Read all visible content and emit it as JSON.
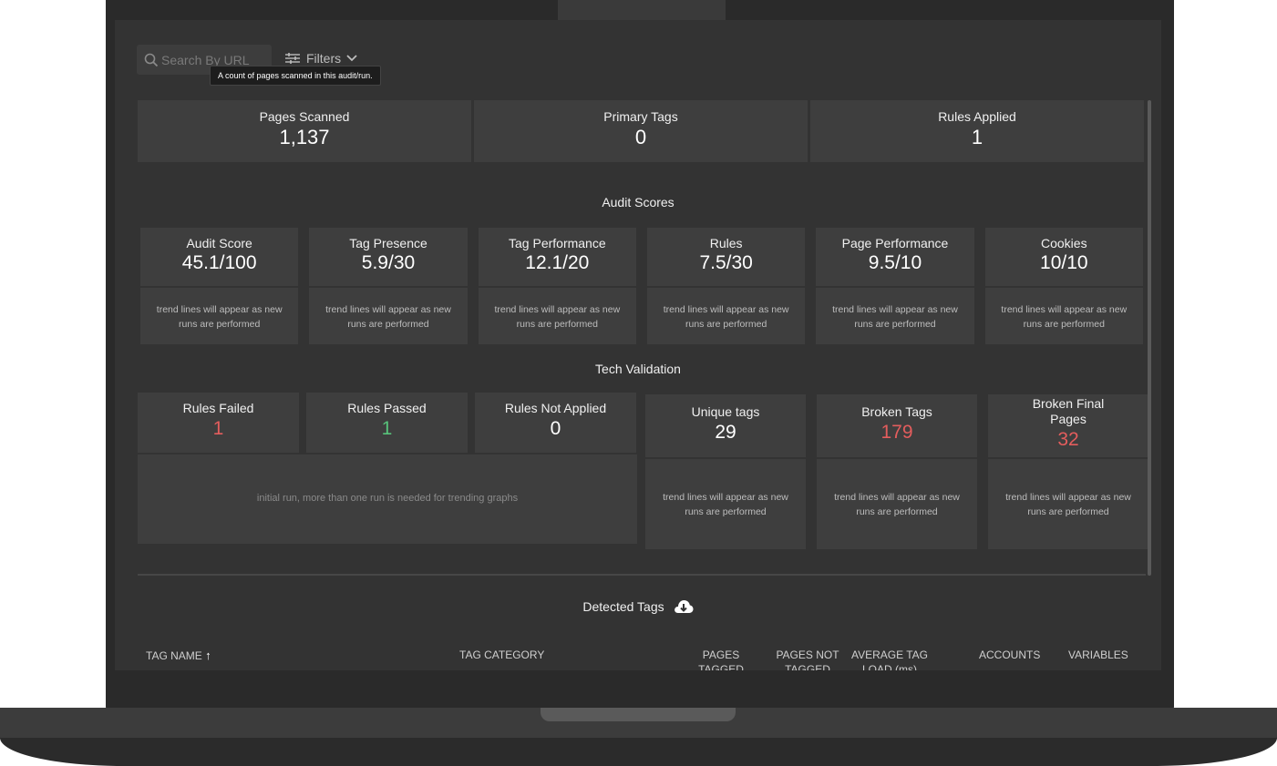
{
  "toolbar": {
    "search_placeholder": "Search By URL",
    "filters_label": "Filters",
    "tooltip": "A count of pages scanned in this audit/run."
  },
  "summary": [
    {
      "label": "Pages Scanned",
      "value": "1,137"
    },
    {
      "label": "Primary Tags",
      "value": "0"
    },
    {
      "label": "Rules Applied",
      "value": "1"
    }
  ],
  "audit_scores": {
    "title": "Audit Scores",
    "cards": [
      {
        "label": "Audit Score",
        "value": "45.1/100",
        "note": "trend lines will appear as new runs are performed"
      },
      {
        "label": "Tag Presence",
        "value": "5.9/30",
        "note": "trend lines will appear as new runs are performed"
      },
      {
        "label": "Tag Performance",
        "value": "12.1/20",
        "note": "trend lines will appear as new runs are performed"
      },
      {
        "label": "Rules",
        "value": "7.5/30",
        "note": "trend lines will appear as new runs are performed"
      },
      {
        "label": "Page Performance",
        "value": "9.5/10",
        "note": "trend lines will appear as new runs are performed"
      },
      {
        "label": "Cookies",
        "value": "10/10",
        "note": "trend lines will appear as new runs are performed"
      }
    ]
  },
  "tech_validation": {
    "title": "Tech Validation",
    "rules": [
      {
        "label": "Rules Failed",
        "value": "1"
      },
      {
        "label": "Rules Passed",
        "value": "1"
      },
      {
        "label": "Rules Not Applied",
        "value": "0"
      }
    ],
    "rules_note": "initial run, more than one run is needed for trending graphs",
    "cards": [
      {
        "label": "Unique tags",
        "value": "29",
        "note": "trend lines will appear as new runs are performed"
      },
      {
        "label": "Broken Tags",
        "value": "179",
        "note": "trend lines will appear as new runs are performed"
      },
      {
        "label": "Broken Final Pages",
        "value": "32",
        "note": "trend lines will appear as new runs are performed"
      }
    ]
  },
  "detected_tags": {
    "title": "Detected Tags",
    "columns": [
      "TAG NAME",
      "TAG CATEGORY",
      "PAGES TAGGED",
      "PAGES NOT TAGGED",
      "AVERAGE TAG LOAD (ms)",
      "ACCOUNTS",
      "VARIABLES"
    ]
  },
  "colors": {
    "bad": "#e35d5d",
    "good": "#57c27a"
  }
}
